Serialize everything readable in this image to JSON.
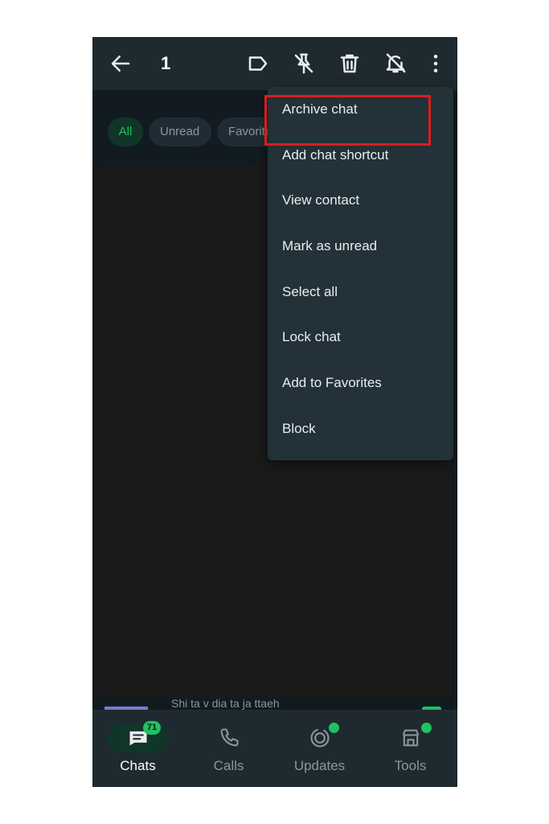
{
  "header": {
    "selected_count": "1",
    "icons": [
      "back-arrow-icon",
      "label-icon",
      "unpin-icon",
      "delete-icon",
      "mute-icon",
      "more-vertical-icon"
    ]
  },
  "filters": [
    {
      "label": "All",
      "active": true
    },
    {
      "label": "Unread",
      "active": false
    },
    {
      "label": "Favorites",
      "active": false
    }
  ],
  "context_menu": {
    "items": [
      {
        "label": "Archive chat",
        "highlighted": true
      },
      {
        "label": "Add chat shortcut"
      },
      {
        "label": "View contact"
      },
      {
        "label": "Mark as unread"
      },
      {
        "label": "Select all"
      },
      {
        "label": "Lock chat"
      },
      {
        "label": "Add to Favorites"
      },
      {
        "label": "Block"
      }
    ]
  },
  "peek_row": {
    "text": "Shi ta  v  dia ta ja ttaeh"
  },
  "bottom_nav": {
    "items": [
      {
        "label": "Chats",
        "icon": "chats-icon",
        "active": true,
        "badge": "71"
      },
      {
        "label": "Calls",
        "icon": "calls-icon",
        "active": false
      },
      {
        "label": "Updates",
        "icon": "updates-icon",
        "active": false,
        "dot": true
      },
      {
        "label": "Tools",
        "icon": "tools-icon",
        "active": false,
        "dot": true
      }
    ]
  },
  "colors": {
    "accent": "#21c063",
    "highlight_border": "#e01b1b",
    "menu_bg": "#233138",
    "bar_bg": "#1f2a30"
  }
}
